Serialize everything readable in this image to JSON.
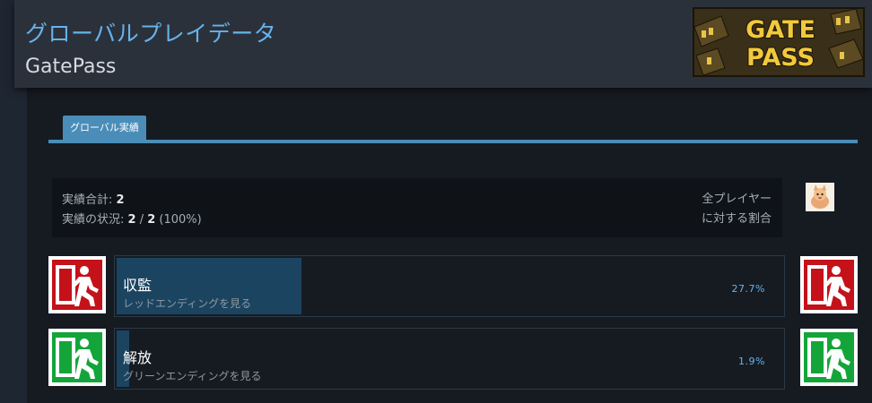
{
  "header": {
    "title": "グローバルプレイデータ",
    "game_name": "GatePass",
    "logo_text": "GATE PASS"
  },
  "tabs": [
    {
      "label": "グローバル実績",
      "active": true
    }
  ],
  "summary": {
    "total_label": "実績合計: ",
    "total_value": "2",
    "status_label": "実績の状況: ",
    "status_value": "2",
    "status_sep": " / ",
    "status_total": "2",
    "status_pct": " (100%)",
    "right_label_line1": "全プレイヤー",
    "right_label_line2": "に対する割合"
  },
  "achievements": [
    {
      "title": "収監",
      "description": "レッドエンディングを見る",
      "percent_text": "27.7%",
      "percent": 27.7,
      "icon": "red-emergency-exit-icon",
      "icon_color": "#c4111a"
    },
    {
      "title": "解放",
      "description": "グリーンエンディングを見る",
      "percent_text": "1.9%",
      "percent": 1.9,
      "icon": "green-emergency-exit-icon",
      "icon_color": "#13a53a"
    }
  ],
  "colors": {
    "accent": "#66b3ea",
    "tab": "#4a8db8",
    "progress_fill": "#1b4461",
    "background": "#1b2129"
  }
}
